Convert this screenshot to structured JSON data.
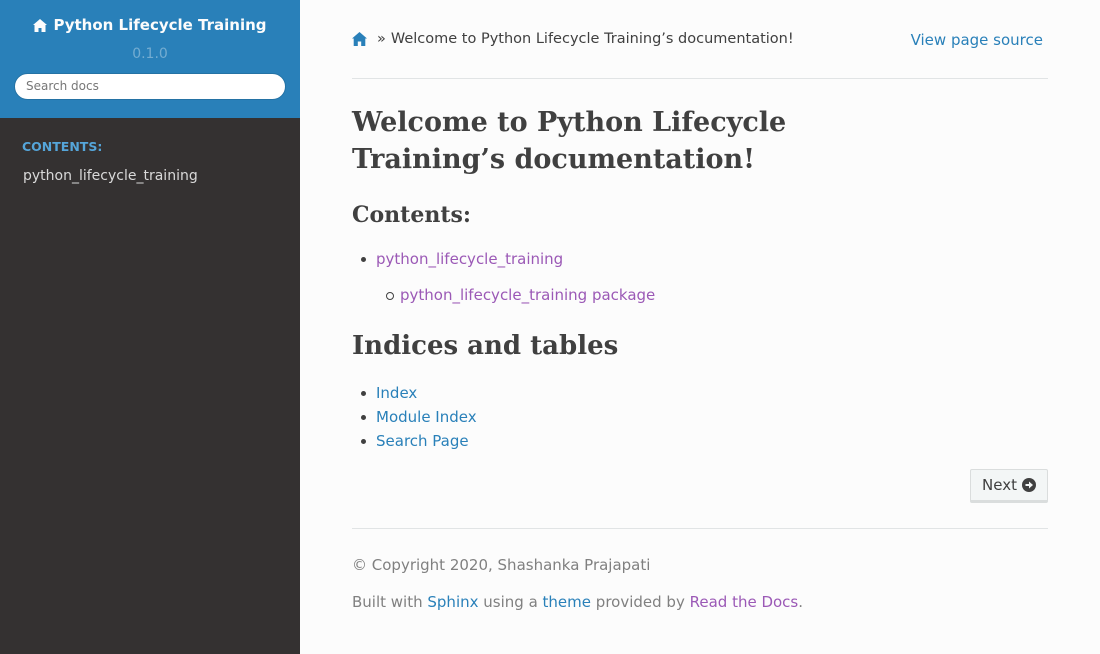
{
  "sidebar": {
    "project_name": "Python Lifecycle Training",
    "version": "0.1.0",
    "search_placeholder": "Search docs",
    "caption": "CONTENTS:",
    "items": [
      {
        "label": "python_lifecycle_training"
      }
    ]
  },
  "breadcrumb": {
    "current": "Welcome to Python Lifecycle Training’s documentation!",
    "separator": "»",
    "view_source": "View page source"
  },
  "page": {
    "title": "Welcome to Python Lifecycle Training’s documentation!",
    "contents_heading": "Contents:",
    "toc": {
      "item": "python_lifecycle_training",
      "subitem": "python_lifecycle_training package"
    },
    "indices_heading": "Indices and tables",
    "indices": [
      "Index",
      "Module Index",
      "Search Page"
    ],
    "next_label": "Next"
  },
  "footer": {
    "copyright": "© Copyright 2020, Shashanka Prajapati",
    "built_prefix": "Built with",
    "sphinx": "Sphinx",
    "using_a": "using a",
    "theme": "theme",
    "provided_by": "provided by",
    "rtd": "Read the Docs",
    "period": "."
  },
  "colors": {
    "sidebar_bg": "#343131",
    "header_blue": "#2980b9",
    "link": "#2980b9",
    "visited_link": "#9b59b6",
    "text": "#404040"
  },
  "icons": {
    "home": "home-icon",
    "next": "circle-arrow-right-icon"
  }
}
